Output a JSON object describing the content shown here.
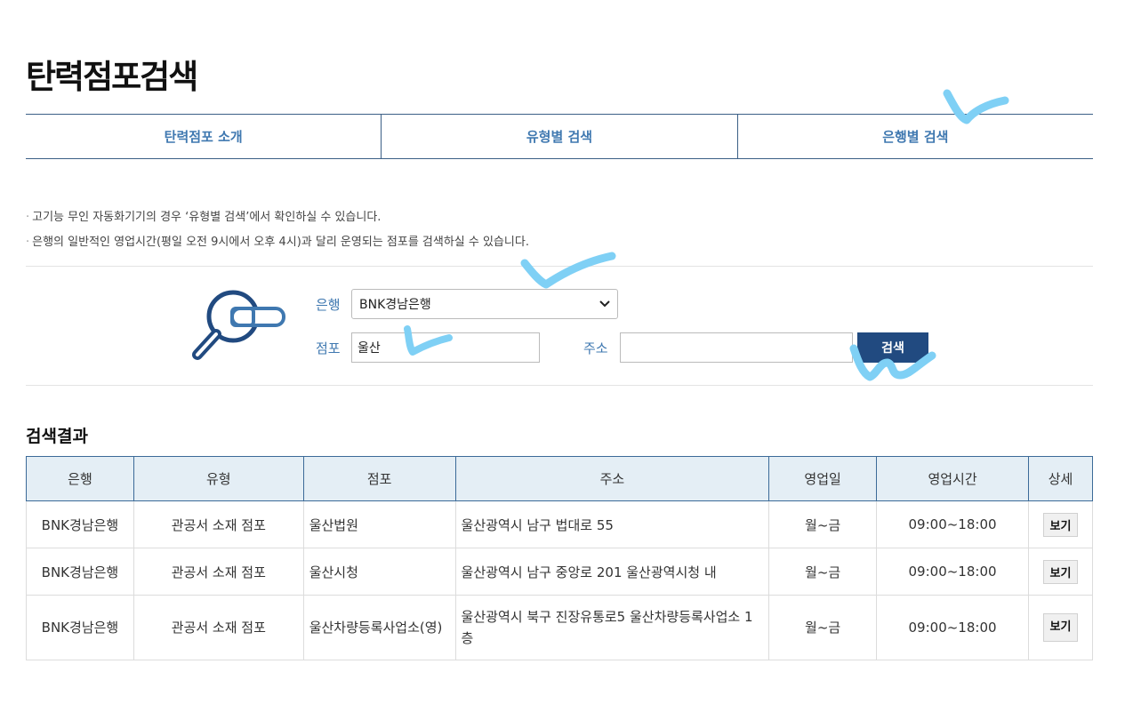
{
  "page": {
    "title": "탄력점포검색"
  },
  "tabs": [
    {
      "label": "탄력점포 소개"
    },
    {
      "label": "유형별 검색"
    },
    {
      "label": "은행별 검색"
    }
  ],
  "notes": [
    "고기능 무인 자동화기기의 경우 ‘유형별 검색’에서 확인하실 수 있습니다.",
    "은행의 일반적인 영업시간(평일 오전 9시에서 오후 4시)과 달리 운영되는 점포를 검색하실 수 있습니다."
  ],
  "form": {
    "bank_label": "은행",
    "bank_value": "BNK경남은행",
    "branch_label": "점포",
    "branch_value": "울산",
    "address_label": "주소",
    "address_value": "",
    "search_label": "검색"
  },
  "results": {
    "title": "검색결과",
    "columns": [
      "은행",
      "유형",
      "점포",
      "주소",
      "영업일",
      "영업시간",
      "상세"
    ],
    "rows": [
      {
        "bank": "BNK경남은행",
        "type": "관공서 소재 점포",
        "branch": "울산법원",
        "address": "울산광역시 남구 법대로 55",
        "days": "월~금",
        "hours": "09:00~18:00",
        "detail": "보기"
      },
      {
        "bank": "BNK경남은행",
        "type": "관공서 소재 점포",
        "branch": "울산시청",
        "address": "울산광역시 남구 중앙로 201 울산광역시청 내",
        "days": "월~금",
        "hours": "09:00~18:00",
        "detail": "보기"
      },
      {
        "bank": "BNK경남은행",
        "type": "관공서 소재 점포",
        "branch": "울산차량등록사업소(영)",
        "address": "울산광역시 북구 진장유통로5 울산차량등록사업소 1층",
        "days": "월~금",
        "hours": "09:00~18:00",
        "detail": "보기"
      }
    ]
  },
  "colors": {
    "accent": "#3f78b0",
    "button": "#214a80",
    "header_bg": "#e4eef5",
    "marker": "#7fd0f5"
  }
}
